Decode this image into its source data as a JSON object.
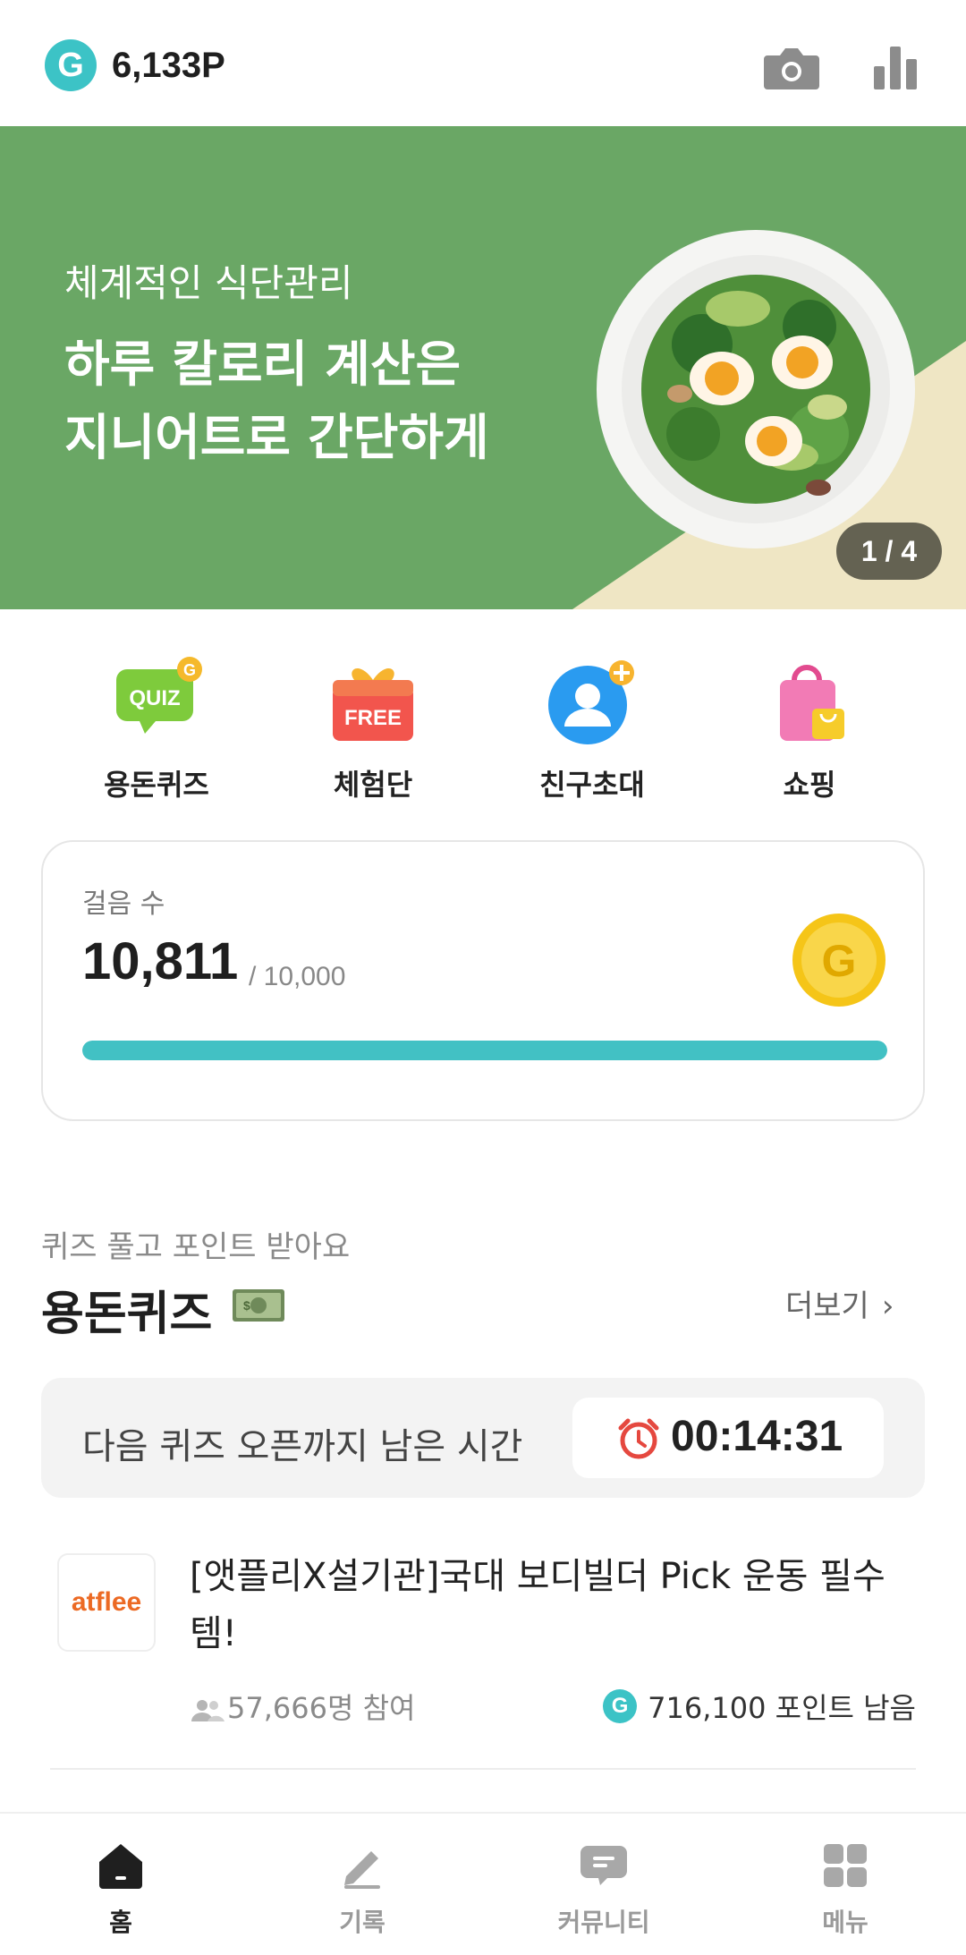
{
  "header": {
    "badge": "G",
    "points": "6,133P",
    "icons": [
      "camera-icon",
      "bar-chart-icon"
    ]
  },
  "banner": {
    "subtitle": "체계적인 식단관리",
    "title_line1": "하루 칼로리 계산은",
    "title_line2": "지니어트로 간단하게",
    "pager": "1 / 4",
    "colors": {
      "green": "#6aa765",
      "cream": "#efe6c4"
    }
  },
  "quick_menu": [
    {
      "label": "용돈퀴즈",
      "icon": "quiz-icon"
    },
    {
      "label": "체험단",
      "icon": "free-gift-icon"
    },
    {
      "label": "친구초대",
      "icon": "invite-friend-icon"
    },
    {
      "label": "쇼핑",
      "icon": "shopping-bag-icon"
    }
  ],
  "steps": {
    "label": "걸음 수",
    "value": "10,811",
    "goal": "/ 10,000",
    "progress": 1.0,
    "accent": "#42c1c4"
  },
  "quiz_section": {
    "subtitle": "퀴즈 풀고 포인트 받아요",
    "title": "용돈퀴즈",
    "more": "더보기",
    "timer_label": "다음 퀴즈 오픈까지 남은 시간",
    "timer_value": "00:14:31",
    "items": [
      {
        "logo_text": "atflee",
        "title": "[앳플리X설기관]국대 보디빌더 Pick 운동 필수템!",
        "participants": "57,666명 참여",
        "remaining": "716,100 포인트 남음",
        "badge": "G"
      }
    ]
  },
  "bottom_nav": [
    {
      "label": "홈",
      "icon": "home-icon",
      "active": true
    },
    {
      "label": "기록",
      "icon": "pencil-icon",
      "active": false
    },
    {
      "label": "커뮤니티",
      "icon": "chat-bubble-icon",
      "active": false
    },
    {
      "label": "메뉴",
      "icon": "grid-menu-icon",
      "active": false
    }
  ]
}
